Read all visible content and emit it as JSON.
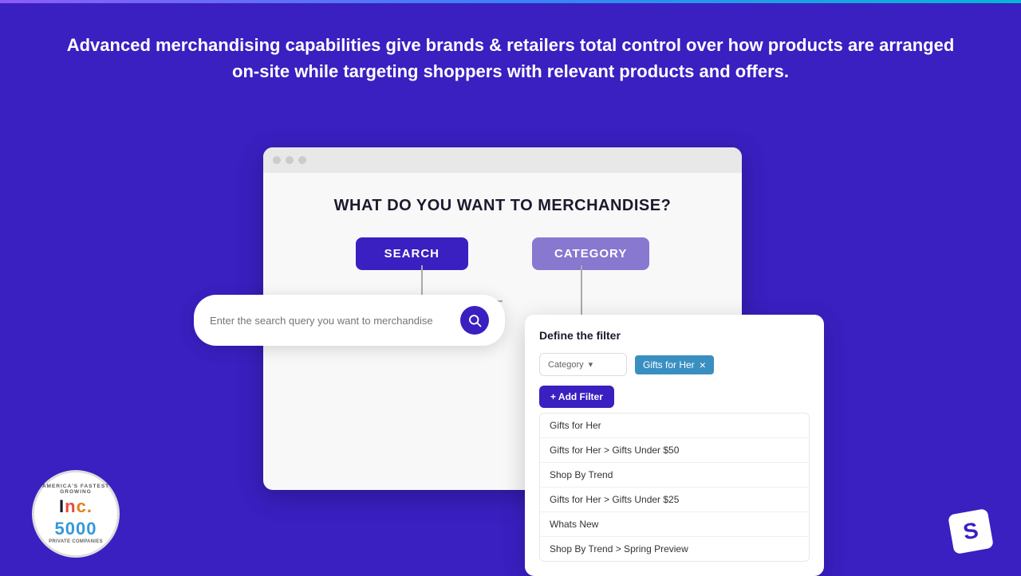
{
  "page": {
    "background_color": "#3a1fc1"
  },
  "headline": {
    "text": "Advanced merchandising capabilities give brands & retailers total control over how products are arranged on-site while targeting shoppers with relevant products and offers."
  },
  "browser": {
    "title": "WHAT DO YOU WANT TO MERCHANDISE?",
    "search_button": "SEARCH",
    "category_button": "CATEGORY"
  },
  "search_box": {
    "placeholder": "Enter the search query you want to merchandise"
  },
  "filter_panel": {
    "title": "Define the filter",
    "dropdown_label": "Category",
    "tag_label": "Gifts for Her",
    "add_filter_label": "+ Add Filter",
    "dropdown_items": [
      "Gifts for Her",
      "Gifts for Her > Gifts Under $50",
      "Shop By Trend",
      "Gifts for Her > Gifts Under $25",
      "Whats New",
      "Shop By Trend > Spring Preview"
    ]
  },
  "inc_badge": {
    "arc_text": "AMERICA'S FASTEST GROWING",
    "main_text": "Inc.",
    "number_text": "5000",
    "sub_text": "PRIVATE COMPANIES"
  },
  "logo": {
    "symbol": "S"
  }
}
